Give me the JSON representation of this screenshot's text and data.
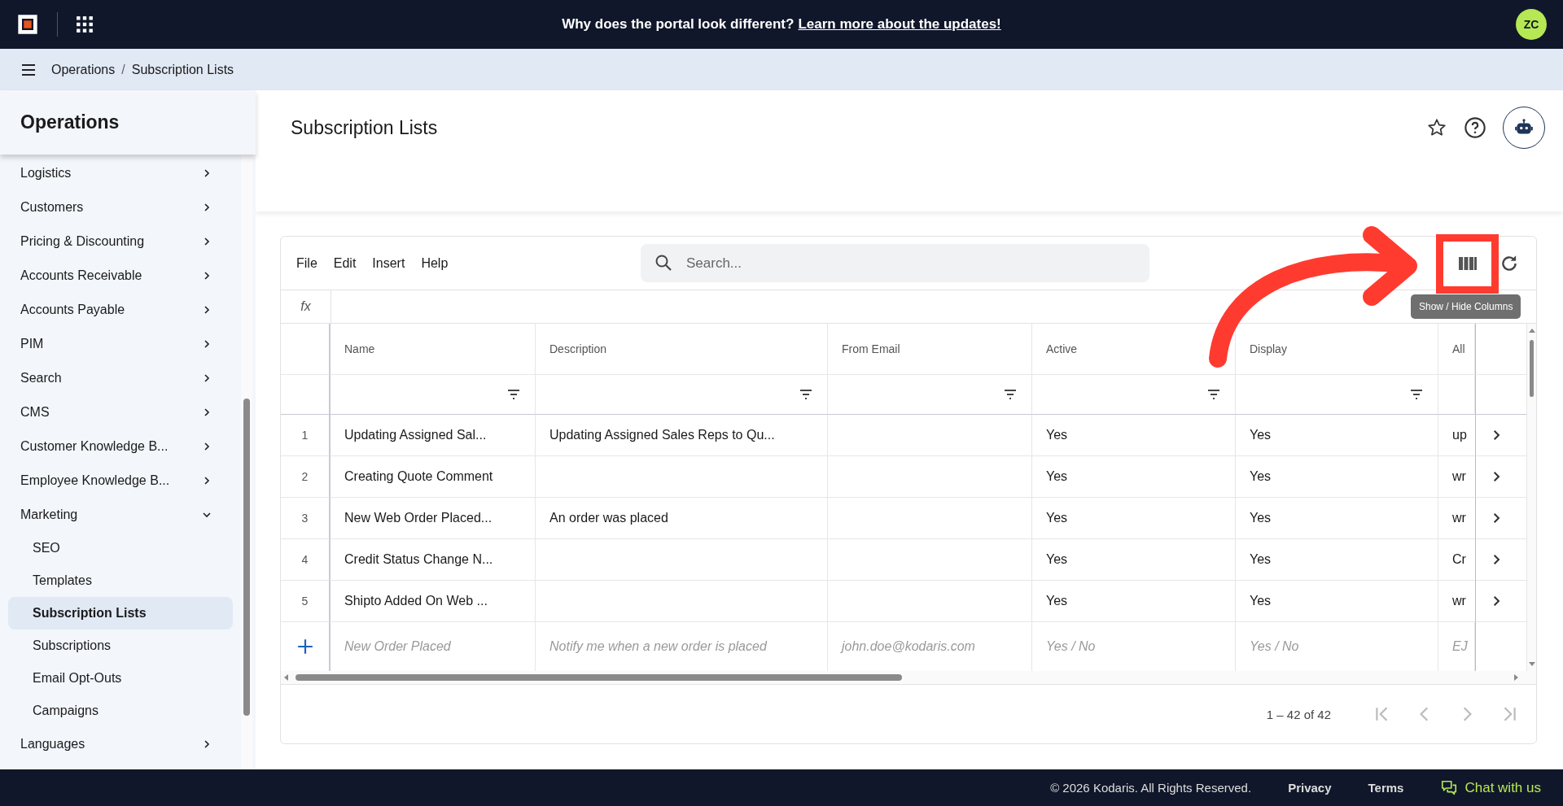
{
  "top_bar": {
    "banner": "Why does the portal look different?",
    "banner_link": "Learn more about the updates!",
    "avatar": "ZC"
  },
  "breadcrumb": {
    "items": [
      "Operations",
      "Subscription Lists"
    ],
    "separator": "/"
  },
  "sidebar": {
    "title": "Operations",
    "items": [
      {
        "label": "Logistics",
        "expanded": false
      },
      {
        "label": "Customers",
        "expanded": false
      },
      {
        "label": "Pricing & Discounting",
        "expanded": false
      },
      {
        "label": "Accounts Receivable",
        "expanded": false
      },
      {
        "label": "Accounts Payable",
        "expanded": false
      },
      {
        "label": "PIM",
        "expanded": false
      },
      {
        "label": "Search",
        "expanded": false
      },
      {
        "label": "CMS",
        "expanded": false
      },
      {
        "label": "Customer Knowledge B...",
        "expanded": false
      },
      {
        "label": "Employee Knowledge B...",
        "expanded": false
      },
      {
        "label": "Marketing",
        "expanded": true,
        "children": [
          {
            "label": "SEO",
            "selected": false
          },
          {
            "label": "Templates",
            "selected": false
          },
          {
            "label": "Subscription Lists",
            "selected": true
          },
          {
            "label": "Subscriptions",
            "selected": false
          },
          {
            "label": "Email Opt-Outs",
            "selected": false
          },
          {
            "label": "Campaigns",
            "selected": false
          }
        ]
      },
      {
        "label": "Languages",
        "expanded": false
      }
    ]
  },
  "page": {
    "title": "Subscription Lists"
  },
  "table": {
    "menus": [
      "File",
      "Edit",
      "Insert",
      "Help"
    ],
    "search": {
      "placeholder": "Search..."
    },
    "formula_label": "fx",
    "tooltip": "Show / Hide Columns",
    "columns": [
      {
        "label": "Name",
        "filterable": true
      },
      {
        "label": "Description",
        "filterable": true
      },
      {
        "label": "From Email",
        "filterable": true
      },
      {
        "label": "Active",
        "filterable": true
      },
      {
        "label": "Display",
        "filterable": true
      },
      {
        "label": "All",
        "filterable": false
      }
    ],
    "rows": [
      {
        "number": "1",
        "cells": [
          "Updating Assigned Sal...",
          "Updating Assigned Sales Reps to Qu...",
          "",
          "Yes",
          "Yes",
          "up"
        ]
      },
      {
        "number": "2",
        "cells": [
          "Creating Quote Comment",
          "",
          "",
          "Yes",
          "Yes",
          "wr"
        ]
      },
      {
        "number": "3",
        "cells": [
          "New Web Order Placed...",
          "An order was placed",
          "",
          "Yes",
          "Yes",
          "wr"
        ]
      },
      {
        "number": "4",
        "cells": [
          "Credit Status Change N...",
          "",
          "",
          "Yes",
          "Yes",
          "Cr"
        ]
      },
      {
        "number": "5",
        "cells": [
          "Shipto Added On Web ...",
          "",
          "",
          "Yes",
          "Yes",
          "wr"
        ]
      }
    ],
    "new_row": {
      "placeholders": [
        "New Order Placed",
        "Notify me when a new order is placed",
        "john.doe@kodaris.com",
        "Yes / No",
        "Yes / No",
        "EJ"
      ]
    },
    "pagination": "1 – 42 of 42"
  },
  "footer": {
    "copyright": "© 2026 Kodaris. All Rights Reserved.",
    "links": [
      "Privacy",
      "Terms"
    ],
    "chat": "Chat with us"
  }
}
